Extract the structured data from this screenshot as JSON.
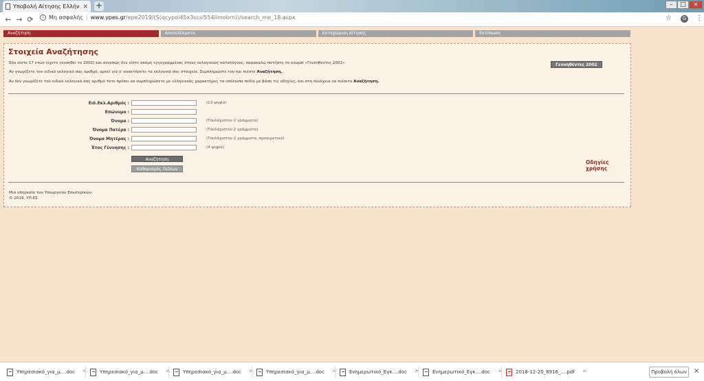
{
  "browser": {
    "tab_title": "Υποβολή Αίτησης Ελλήνα Κάτοι",
    "tab_close": "×",
    "new_tab": "+",
    "window_min": "–",
    "window_max": "□",
    "window_close": "×",
    "back": "←",
    "forward": "→",
    "reload": "⟳",
    "security_label": "Μη ασφαλής",
    "url_host": "www.ypes.gr",
    "url_path": "/epe2019/(S(qcypoi45x3scsl554iimobrn))/search_me_18.aspx",
    "star": "☆",
    "avatar": "G",
    "menu": "⋮"
  },
  "nav_tabs": [
    {
      "label": "Αναζήτηση",
      "active": true
    },
    {
      "label": "Αποτελέσματα",
      "active": false
    },
    {
      "label": "Καταχώριση Αίτησης",
      "active": false
    },
    {
      "label": "Εκτύπωση",
      "active": false
    }
  ],
  "panel": {
    "heading": "Στοιχεία Αναζήτησης",
    "intro_1": "Εάν είστε 17 ετών (έχετε γεννηθεί το 2002) και συνεπώς δεν είστε ακόμη εγγεγραμμένος στους εκλογικούς καταλόγους, παρακαλώ πατήστε το κουμπί «Γεννηθέντες 2002»",
    "intro_2_pre": "Αν γνωρίζετε τον ειδικό εκλογικό σας αριθμό, αρκεί για ν' ανακτήσετε τα εκλογικά σας στοιχεία. Συμπληρώστε τον και πιέστε ",
    "intro_2_bold": "Αναζήτηση.",
    "intro_3_pre": "Αν δεν γνωρίζετε τον ειδικό εκλογικό σας αριθμό τότε πρέπει να συμπληρώσετε με ελληνικούς χαρακτήρες τα υπόλοιπα πεδία με βάση τις οδηγίες, και στη συνέχεια να πιέσετε ",
    "intro_3_bold": "Αναζήτηση.",
    "born_button": "Γεννηθέντες 2002"
  },
  "form": {
    "fields": [
      {
        "label": "Ειδ.Εκλ.Αριθμός :",
        "hint": "(13 ψηφία)"
      },
      {
        "label": "Επώνυμο :",
        "hint": ""
      },
      {
        "label": "Όνομα :",
        "hint": "(Τουλάχιστον 2 γράμματα)"
      },
      {
        "label": "Όνομα Πατέρα :",
        "hint": "(Τουλάχιστον 2 γράμματα)"
      },
      {
        "label": "Όνομα Μητέρας :",
        "hint": "(Τουλάχιστον 2 γράμματα, προαιρετικό)"
      },
      {
        "label": "Έτος Γέννησης :",
        "hint": "(4 ψηφία)"
      }
    ],
    "search_button": "Αναζήτηση",
    "clear_button": "Καθορισμός Πεδίων",
    "help_link": "Οδηγίες χρήσης"
  },
  "footer": {
    "line_1": "Μια υπηρεσία του Υπουργείου Εσωτερικών.",
    "line_2": "© 2019, ΥΠ.ΕΣ."
  },
  "downloads": {
    "items": [
      {
        "name": "Υπηρεσιακό_για_μ....doc",
        "type": "doc"
      },
      {
        "name": "Υπηρεσιακό_για_μ....doc",
        "type": "doc"
      },
      {
        "name": "Υπηρεσιακό_για_μ....doc",
        "type": "doc"
      },
      {
        "name": "Υπηρεσιακό_για_μ....doc",
        "type": "doc"
      },
      {
        "name": "Ενημερωτικό_Εγκ....doc",
        "type": "doc"
      },
      {
        "name": "Ενημερωτικό_Εγκ....doc",
        "type": "doc"
      },
      {
        "name": "2018-12-20_8916_....pdf",
        "type": "pdf"
      }
    ],
    "show_all": "Προβολή όλων",
    "close": "×"
  }
}
